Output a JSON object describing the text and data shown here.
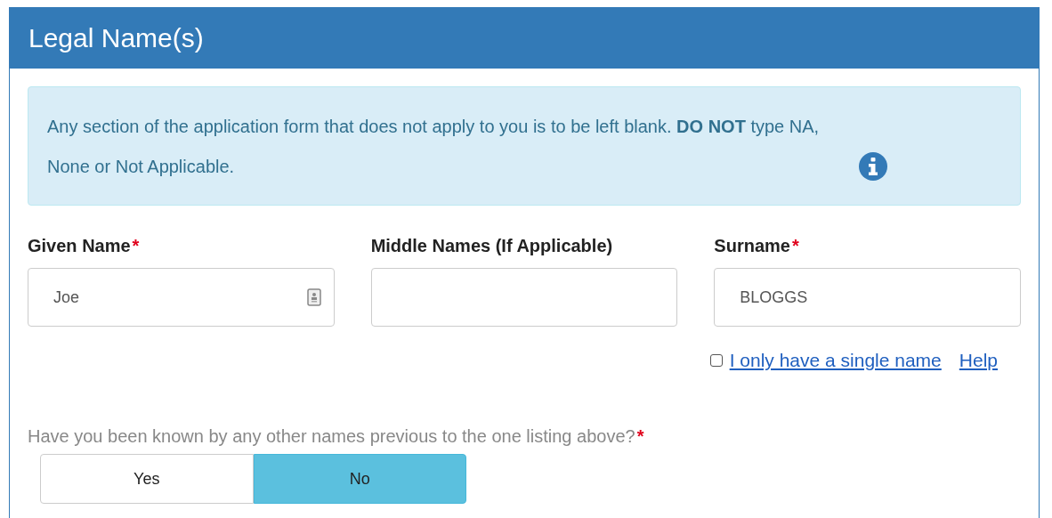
{
  "panel": {
    "title": "Legal Name(s)"
  },
  "notice": {
    "text": "Any section of the application form that does not apply to you is to be left blank. **DO NOT** type NA, None or Not Applicable."
  },
  "fields": [
    {
      "label": "Given Name",
      "required_mark": "*",
      "value": "Joe",
      "kind": "autofill"
    },
    {
      "label": "Middle Names (If Applicable)",
      "kind": "plain"
    },
    {
      "label": "Surname",
      "required_mark": "*",
      "value": "BLOGGS",
      "kind": "plain"
    }
  ],
  "single_name": {
    "label": "I only have a single name",
    "checked": false,
    "help": "Help"
  },
  "question": {
    "text": "Have you been known by any other names previous to the one listing above?",
    "required_mark": "*",
    "options": [
      {
        "label": "Yes",
        "selected": false
      },
      {
        "label": "No",
        "selected": true
      }
    ]
  }
}
